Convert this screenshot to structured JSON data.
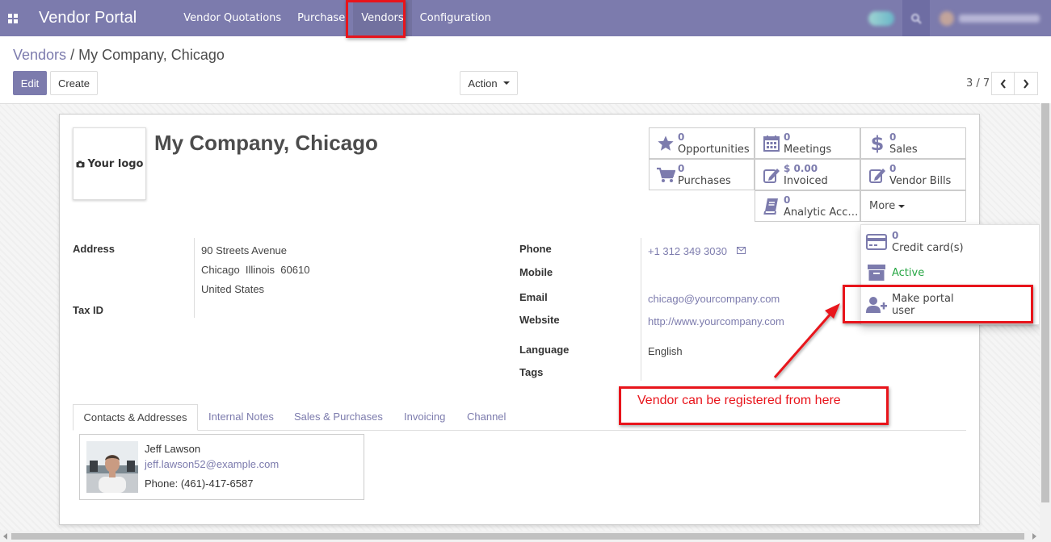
{
  "navbar": {
    "app_title": "Vendor Portal",
    "menu": [
      "Vendor Quotations",
      "Purchase",
      "Vendors",
      "Configuration"
    ]
  },
  "breadcrumb": {
    "parent": "Vendors",
    "separator": "/",
    "current": "My Company, Chicago"
  },
  "toolbar": {
    "edit_label": "Edit",
    "create_label": "Create",
    "action_label": "Action"
  },
  "pager": {
    "value": "3 / 7"
  },
  "record": {
    "logo_text": "Your logo",
    "name": "My Company, Chicago"
  },
  "smart_buttons": [
    {
      "icon": "star-icon",
      "value": "0",
      "label": "Opportunities"
    },
    {
      "icon": "calendar-icon",
      "value": "0",
      "label": "Meetings"
    },
    {
      "icon": "dollar-icon",
      "value": "0",
      "label": "Sales"
    },
    {
      "icon": "cart-icon",
      "value": "0",
      "label": "Purchases"
    },
    {
      "icon": "pencil-square-icon",
      "value": "$ 0.00",
      "label": "Invoiced"
    },
    {
      "icon": "pencil-square-icon",
      "value": "0",
      "label": "Vendor Bills"
    },
    {
      "icon": "book-icon",
      "value": "0",
      "label": "Analytic Acc…"
    }
  ],
  "more_label": "More",
  "more_menu": {
    "credit_cards": {
      "value": "0",
      "label": "Credit card(s)"
    },
    "active_label": "Active",
    "portal_line1": "Make portal",
    "portal_line2": "user"
  },
  "fields": {
    "address_label": "Address",
    "street": "90 Streets Avenue",
    "city_line": "Chicago  Illinois  60610",
    "country": "United States",
    "tax_id_label": "Tax ID",
    "phone_label": "Phone",
    "phone": "+1 312 349 3030",
    "mobile_label": "Mobile",
    "email_label": "Email",
    "email": "chicago@yourcompany.com",
    "website_label": "Website",
    "website": "http://www.yourcompany.com",
    "language_label": "Language",
    "language": "English",
    "tags_label": "Tags"
  },
  "tabs": [
    "Contacts & Addresses",
    "Internal Notes",
    "Sales & Purchases",
    "Invoicing",
    "Channel"
  ],
  "contact": {
    "name": "Jeff Lawson",
    "email": "jeff.lawson52@example.com",
    "phone": "Phone: (461)-417-6587"
  },
  "annotation": {
    "text": "Vendor can be registered from here",
    "color": "#e8141b"
  },
  "colors": {
    "brand": "#7c7bad",
    "active_green": "#28a745"
  }
}
